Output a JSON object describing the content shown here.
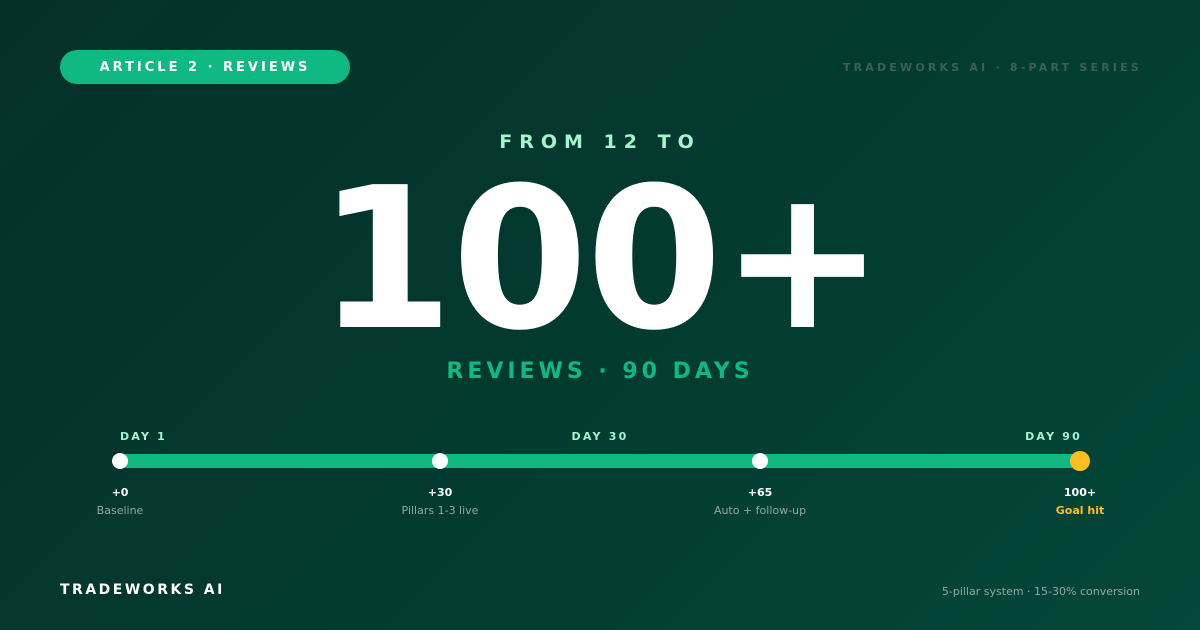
{
  "badge": "ARTICLE 2 · REVIEWS",
  "series": "TRADEWORKS AI · 8-PART SERIES",
  "headline": {
    "from": "FROM 12 TO",
    "big": "100+",
    "sub": "REVIEWS · 90 DAYS"
  },
  "timeline": {
    "days": [
      "DAY 1",
      "DAY 30",
      "DAY 90"
    ],
    "milestones": [
      {
        "value": "+0",
        "label": "Baseline"
      },
      {
        "value": "+30",
        "label": "Pillars 1-3 live"
      },
      {
        "value": "+65",
        "label": "Auto + follow-up"
      },
      {
        "value": "100+",
        "label": "Goal hit"
      }
    ]
  },
  "footer": {
    "brand": "TRADEWORKS AI",
    "note": "5-pillar system · 15-30% conversion"
  },
  "colors": {
    "accent": "#10b981",
    "goal": "#fbbf24",
    "mint": "#a7f3d0"
  }
}
